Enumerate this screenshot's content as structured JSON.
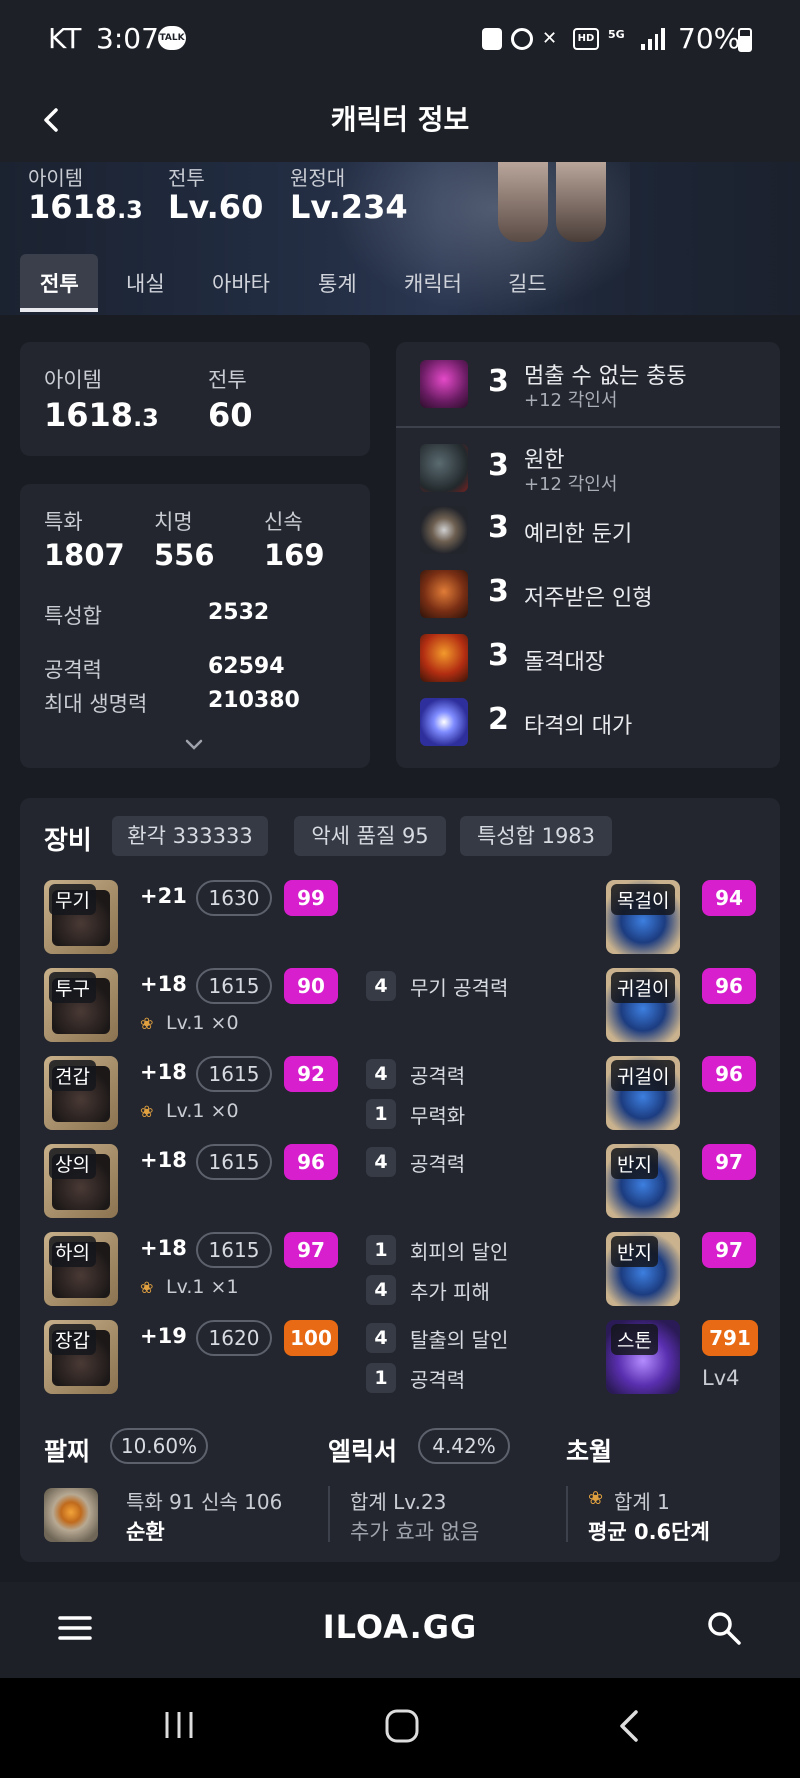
{
  "status_bar": {
    "carrier": "KT",
    "time": "3:07",
    "battery": "70%"
  },
  "header": {
    "title": "캐릭터 정보"
  },
  "hero": {
    "item_label": "아이템",
    "item_value": "1618",
    "item_value_decimal": ".3",
    "combat_label": "전투",
    "combat_value": "Lv.60",
    "expedition_label": "원정대",
    "expedition_value": "Lv.234"
  },
  "tabs": [
    {
      "label": "전투"
    },
    {
      "label": "내실"
    },
    {
      "label": "아바타"
    },
    {
      "label": "통계"
    },
    {
      "label": "캐릭터"
    },
    {
      "label": "길드"
    }
  ],
  "summary": {
    "item_label": "아이템",
    "item_value": "1618",
    "item_value_decimal": ".3",
    "combat_label": "전투",
    "combat_value": "60"
  },
  "stats": {
    "crit_spec_label": "특화",
    "crit_spec_value": "1807",
    "crit_label": "치명",
    "crit_value": "556",
    "swift_label": "신속",
    "swift_value": "169",
    "total_label": "특성합",
    "total_value": "2532",
    "atk_label": "공격력",
    "atk_value": "62594",
    "hp_label": "최대 생명력",
    "hp_value": "210380"
  },
  "engravings": [
    {
      "level": "3",
      "name": "멈출 수 없는 충동",
      "sub": "+12 각인서",
      "icon": "purple-demon-icon"
    },
    {
      "level": "3",
      "name": "원한",
      "sub": "+12 각인서",
      "icon": "dark-beast-icon"
    },
    {
      "level": "3",
      "name": "예리한 둔기",
      "sub": "",
      "icon": "orb-icon"
    },
    {
      "level": "3",
      "name": "저주받은 인형",
      "sub": "",
      "icon": "cursed-doll-icon"
    },
    {
      "level": "3",
      "name": "돌격대장",
      "sub": "",
      "icon": "fire-charge-icon"
    },
    {
      "level": "2",
      "name": "타격의 대가",
      "sub": "",
      "icon": "lightning-strike-icon"
    }
  ],
  "equipment": {
    "title": "장비",
    "chips": [
      "환각 333333",
      "악세 품질 95",
      "특성합 1983"
    ],
    "items": [
      {
        "slot": "무기",
        "plus": "+21",
        "ilvl": "1630",
        "quality": "99",
        "q_color": "#d81fce",
        "elixir": "",
        "effects": []
      },
      {
        "slot": "투구",
        "plus": "+18",
        "ilvl": "1615",
        "quality": "90",
        "q_color": "#d81fce",
        "elixir": "Lv.1  ×0",
        "effects": [
          {
            "n": "4",
            "t": "무기 공격력"
          }
        ]
      },
      {
        "slot": "견갑",
        "plus": "+18",
        "ilvl": "1615",
        "quality": "92",
        "q_color": "#d81fce",
        "elixir": "Lv.1  ×0",
        "effects": [
          {
            "n": "4",
            "t": "공격력"
          },
          {
            "n": "1",
            "t": "무력화"
          }
        ]
      },
      {
        "slot": "상의",
        "plus": "+18",
        "ilvl": "1615",
        "quality": "96",
        "q_color": "#d81fce",
        "elixir": "",
        "effects": [
          {
            "n": "4",
            "t": "공격력"
          }
        ]
      },
      {
        "slot": "하의",
        "plus": "+18",
        "ilvl": "1615",
        "quality": "97",
        "q_color": "#d81fce",
        "elixir": "Lv.1  ×1",
        "effects": [
          {
            "n": "1",
            "t": "회피의 달인"
          },
          {
            "n": "4",
            "t": "추가 피해"
          }
        ]
      },
      {
        "slot": "장갑",
        "plus": "+19",
        "ilvl": "1620",
        "quality": "100",
        "q_color": "#e86a14",
        "elixir": "",
        "effects": [
          {
            "n": "4",
            "t": "탈출의 달인"
          },
          {
            "n": "1",
            "t": "공격력"
          }
        ]
      }
    ],
    "accessories": [
      {
        "slot": "목걸이",
        "quality": "94",
        "q_color": "#d81fce",
        "extra": ""
      },
      {
        "slot": "귀걸이",
        "quality": "96",
        "q_color": "#d81fce",
        "extra": ""
      },
      {
        "slot": "귀걸이",
        "quality": "96",
        "q_color": "#d81fce",
        "extra": ""
      },
      {
        "slot": "반지",
        "quality": "97",
        "q_color": "#d81fce",
        "extra": ""
      },
      {
        "slot": "반지",
        "quality": "97",
        "q_color": "#d81fce",
        "extra": ""
      },
      {
        "slot": "스톤",
        "quality": "791",
        "q_color": "#e86a14",
        "extra": "Lv4"
      }
    ]
  },
  "bracelet": {
    "label": "팔찌",
    "percent": "10.60%",
    "stats": "특화 91  신속 106",
    "effect": "순환"
  },
  "elixir": {
    "label": "엘릭서",
    "percent": "4.42%",
    "total": "합계 Lv.23",
    "effect": "추가 효과 없음"
  },
  "transcend": {
    "label": "초월",
    "total": "합계 1",
    "avg": "평균 0.6단계"
  },
  "bottom_nav": {
    "logo": "ILOA.GG"
  }
}
